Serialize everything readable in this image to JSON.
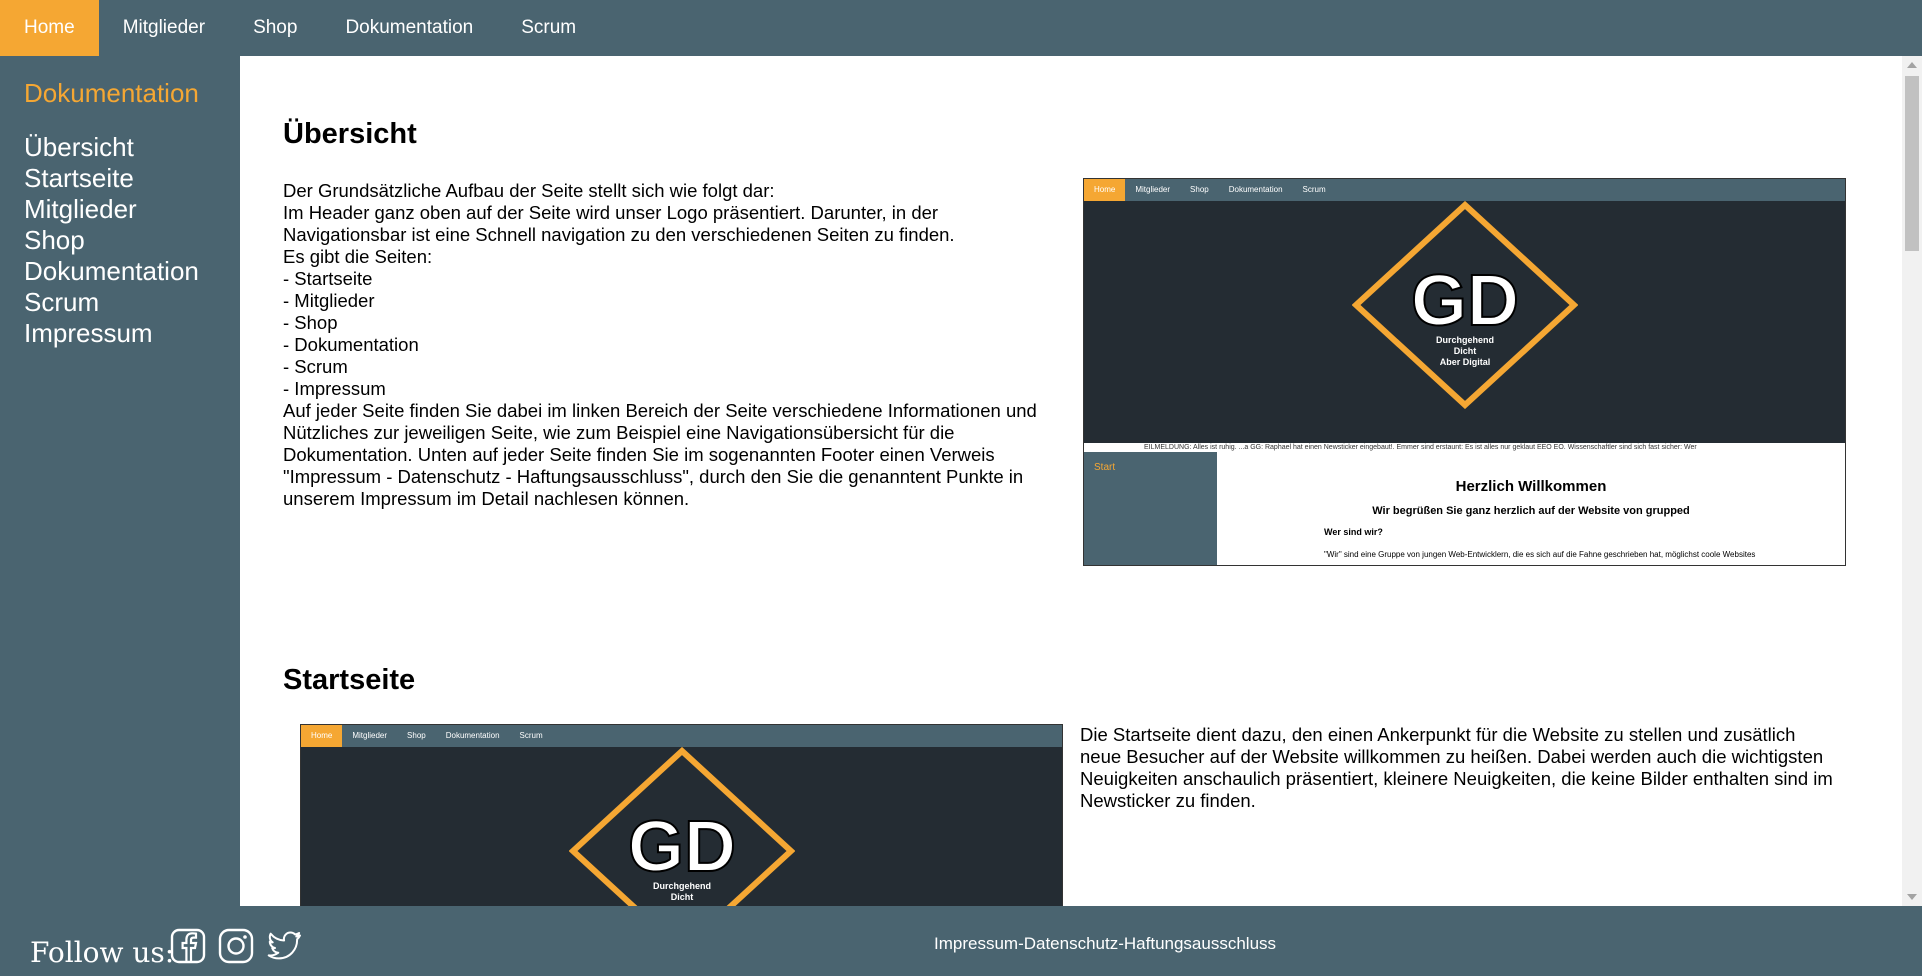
{
  "nav": {
    "items": [
      {
        "label": "Home",
        "active": true
      },
      {
        "label": "Mitglieder",
        "active": false
      },
      {
        "label": "Shop",
        "active": false
      },
      {
        "label": "Dokumentation",
        "active": false
      },
      {
        "label": "Scrum",
        "active": false
      }
    ]
  },
  "sidebar": {
    "title": "Dokumentation",
    "links": [
      "Übersicht",
      "Startseite",
      "Mitglieder",
      "Shop",
      "Dokumentation",
      "Scrum",
      "Impressum"
    ]
  },
  "sections": {
    "overview": {
      "heading": "Übersicht",
      "text": "Der Grundsätzliche Aufbau der Seite stellt sich wie folgt dar:\nIm Header ganz oben auf der Seite wird unser Logo präsentiert. Darunter, in der\nNavigationsbar ist eine Schnell navigation zu den verschiedenen Seiten zu finden.\nEs gibt die Seiten:\n- Startseite\n- Mitglieder\n- Shop\n- Dokumentation\n- Scrum\n- Impressum\nAuf jeder Seite finden Sie dabei im linken Bereich der Seite verschiedene Informationen und\nNützliches zur jeweiligen Seite, wie zum Beispiel eine Navigationsübersicht für die\nDokumentation. Unten auf jeder Seite finden Sie im sogenannten Footer einen Verweis\n\"Impressum - Datenschutz - Haftungsausschluss\", durch den Sie die genanntent Punkte in\nunserem Impressum im Detail nachlesen können."
    },
    "start": {
      "heading": "Startseite",
      "text": "Die Startseite dient dazu, den einen Ankerpunkt für die Website zu stellen und zusätlich\nneue Besucher auf der Website willkommen zu heißen. Dabei werden auch die wichtigsten\nNeuigkeiten anschaulich präsentiert, kleinere Neuigkeiten, die keine Bilder enthalten sind im\nNewsticker zu finden."
    }
  },
  "preview": {
    "nav": [
      "Home",
      "Mitglieder",
      "Shop",
      "Dokumentation",
      "Scrum"
    ],
    "logo_letters": "GD",
    "logo_line1": "Durchgehend",
    "logo_line2": "Dicht",
    "logo_line3": "Aber Digital",
    "ticker": "EILMELDUNG: Alles ist ruhig.          ...a GG: Raphael hat einen Newsticker eingebaut!.          Emmer sind erstaunt: Es ist alles nur geklaut EEO EO.          Wissenschaftler sind sich fast sicher: Wer",
    "sidebar_label": "Start",
    "welcome_title": "Herzlich Willkommen",
    "welcome_sub": "Wir begrüßen Sie ganz herzlich auf der Website von grupped",
    "who": "Wer sind wir?",
    "who_text": "\"Wir\" sind eine Gruppe von jungen Web-Entwicklern, die es sich auf die Fahne geschrieben hat, möglichst coole Websites"
  },
  "footer": {
    "follow_label": "Follow us:",
    "social": [
      "facebook-icon",
      "instagram-icon",
      "twitter-icon"
    ],
    "imprint_link": "Impressum-Datenschutz-Haftungsausschluss"
  },
  "colors": {
    "accent": "#f5a733",
    "nav_bg": "#4a6470",
    "dark_bg": "#242c33"
  }
}
